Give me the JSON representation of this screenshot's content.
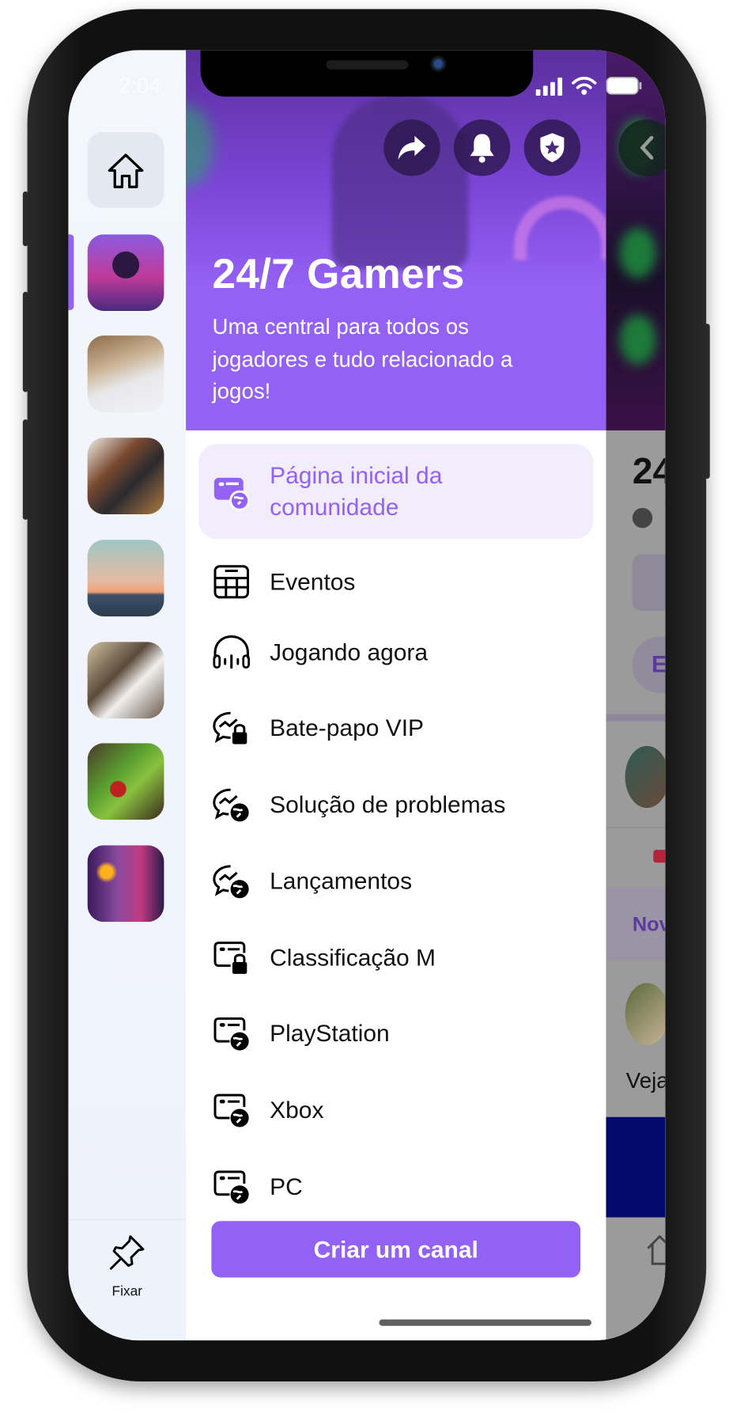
{
  "status_bar": {
    "time": "2:04"
  },
  "sidebar": {
    "home_icon": "home-icon",
    "communities": [
      {
        "name": "gamers-avatar",
        "selected": true
      },
      {
        "name": "cat-avatar"
      },
      {
        "name": "music-avatar"
      },
      {
        "name": "sunset-avatar"
      },
      {
        "name": "workshop-avatar"
      },
      {
        "name": "vegetables-avatar"
      },
      {
        "name": "neon-portrait-avatar"
      }
    ],
    "pin_label": "Fixar"
  },
  "header": {
    "title": "24/7 Gamers",
    "description": "Uma central para todos os jogadores e tudo relacionado a jogos!",
    "actions": [
      "share-icon",
      "bell-icon",
      "shield-star-icon"
    ]
  },
  "menu": {
    "items": [
      {
        "label": "Página inicial da comunidade",
        "icon": "community-home-icon",
        "selected": true
      },
      {
        "label": "Eventos",
        "icon": "calendar-icon"
      },
      {
        "label": "Jogando agora",
        "icon": "headphones-icon"
      },
      {
        "label": "Bate-papo VIP",
        "icon": "chat-lock-icon"
      },
      {
        "label": "Solução de problemas",
        "icon": "chat-globe-icon"
      },
      {
        "label": "Lançamentos",
        "icon": "chat-globe-icon"
      },
      {
        "label": "Classificação M",
        "icon": "channel-lock-icon"
      },
      {
        "label": "PlayStation",
        "icon": "channel-globe-icon"
      },
      {
        "label": "Xbox",
        "icon": "channel-globe-icon"
      },
      {
        "label": "PC",
        "icon": "channel-globe-icon"
      }
    ],
    "create_button": "Criar um canal"
  },
  "background_page": {
    "title_fragment": "24",
    "button_fragment": "E",
    "tab_fragment": "Nov",
    "post_fragment": "Veja"
  },
  "colors": {
    "accent": "#9461f5",
    "selected_bg": "#f1edfd"
  }
}
